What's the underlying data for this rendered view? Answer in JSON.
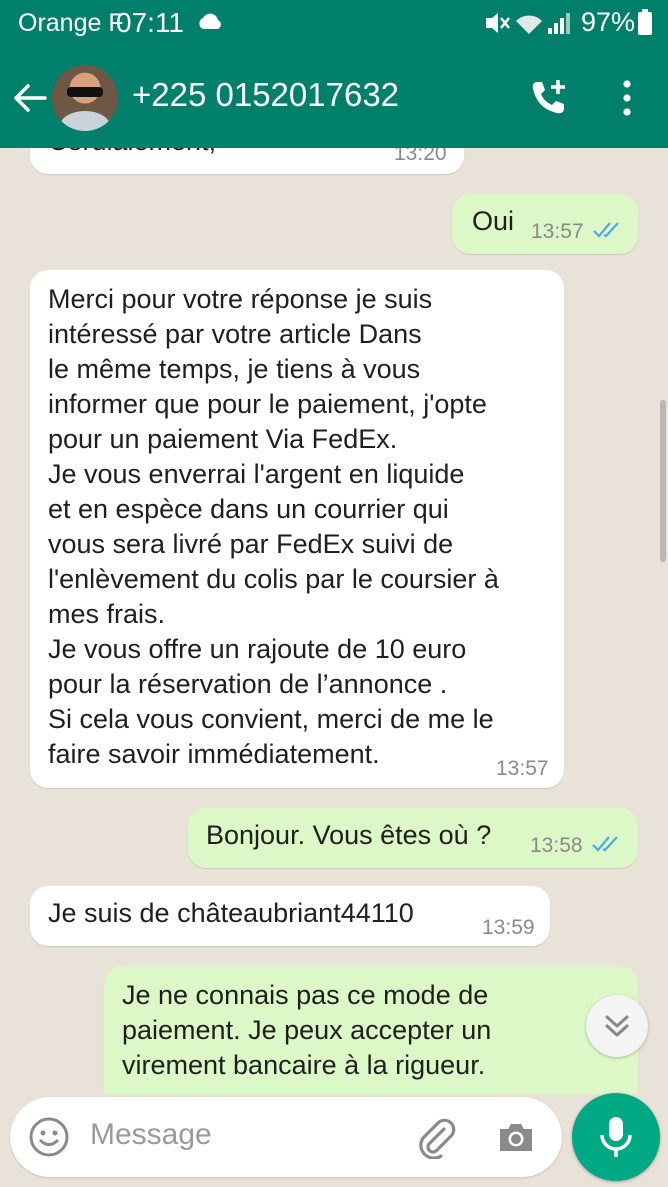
{
  "status_bar": {
    "carrier": "Orange F",
    "time": "07:11",
    "battery": "97%"
  },
  "header": {
    "contact": "+225 0152017632"
  },
  "messages": [
    {
      "direction": "in",
      "text": "Cordialement,",
      "time": "13:20"
    },
    {
      "direction": "out",
      "text": "Oui",
      "time": "13:57",
      "status": "read"
    },
    {
      "direction": "in",
      "lines": [
        "Merci pour votre réponse je suis",
        "intéressé par votre article Dans",
        "le même temps, je tiens à vous",
        "informer que pour le paiement, j'opte",
        "pour un paiement Via FedEx.",
        "Je vous enverrai l'argent en liquide",
        "et en espèce dans un courrier qui",
        "vous sera livré par FedEx suivi de",
        "l'enlèvement du colis par le coursier à",
        "mes frais.",
        "Je vous offre un rajoute de 10 euro",
        "pour la réservation de l’annonce .",
        "Si cela vous convient, merci de me le",
        "faire savoir immédiatement."
      ],
      "time": "13:57"
    },
    {
      "direction": "out",
      "text": "Bonjour. Vous êtes où ?",
      "time": "13:58",
      "status": "read"
    },
    {
      "direction": "in",
      "text": "Je suis de châteaubriant44110",
      "time": "13:59"
    },
    {
      "direction": "out",
      "lines": [
        "Je ne connais pas ce mode de",
        "paiement. Je peux accepter un",
        "virement bancaire à la rigueur."
      ]
    }
  ],
  "input": {
    "placeholder": "Message"
  },
  "colors": {
    "header": "#00806b",
    "outgoing_bubble": "#dcf8c6",
    "incoming_bubble": "#ffffff",
    "read_ticks": "#4fa9e6",
    "mic_button": "#00a884"
  },
  "icons": [
    "back-arrow-icon",
    "add-call-icon",
    "more-vert-icon",
    "emoji-icon",
    "attach-icon",
    "camera-icon",
    "mic-icon",
    "double-chevron-down-icon",
    "read-ticks-icon"
  ]
}
